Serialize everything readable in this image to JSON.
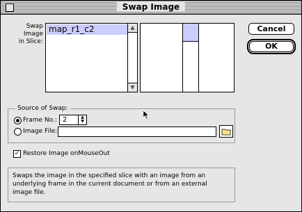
{
  "window": {
    "title": "Swap Image"
  },
  "slice": {
    "label_line1": "Swap Image",
    "label_line2": "in Slice:",
    "items": [
      "map_r1_c2"
    ],
    "selected": "map_r1_c2"
  },
  "buttons": {
    "cancel": "Cancel",
    "ok": "OK"
  },
  "source": {
    "legend": "Source of Swap:",
    "frame_label": "Frame No.:",
    "frame_value": "2",
    "image_file_label": "Image File:",
    "image_file_value": "",
    "selected_option": "frame"
  },
  "restore": {
    "label": "Restore Image onMouseOut",
    "checked": true
  },
  "description": {
    "text": "Swaps the image in the specified slice with an image from an underlying frame in the current document or from an external image file."
  },
  "icons": {
    "close": "close-box-icon",
    "folder": "folder-icon",
    "cursor": "arrow-cursor-icon",
    "check": "checkmark-icon"
  },
  "colors": {
    "selection": "#ccccff",
    "window_bg": "#e6e6e6"
  }
}
